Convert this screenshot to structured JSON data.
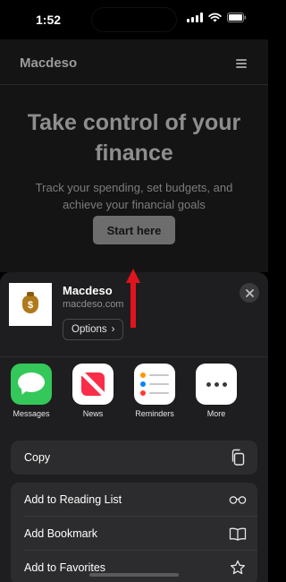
{
  "status": {
    "time": "1:52"
  },
  "site": {
    "brand": "Macdeso",
    "hero_title": "Take control of your finance",
    "hero_subtitle": "Track your spending, set budgets, and achieve your financial goals",
    "cta_label": "Start here"
  },
  "share": {
    "app_name": "Macdeso",
    "app_url": "macdeso.com",
    "options_label": "Options",
    "options_chevron": "›",
    "thumb_glyph": "$",
    "apps": [
      {
        "label": "Messages",
        "icon": "messages-icon"
      },
      {
        "label": "News",
        "icon": "news-icon"
      },
      {
        "label": "Reminders",
        "icon": "reminders-icon"
      },
      {
        "label": "More",
        "icon": "more-icon"
      }
    ],
    "actions": {
      "copy": "Copy",
      "reading_list": "Add to Reading List",
      "bookmark": "Add Bookmark",
      "favorites": "Add to Favorites"
    }
  },
  "colors": {
    "background": "#141414",
    "sheet": "#1e1e20",
    "row": "#2c2c2e",
    "annotation_arrow": "#e0141e",
    "messages": "#34c759",
    "news": "#fa2d48"
  }
}
